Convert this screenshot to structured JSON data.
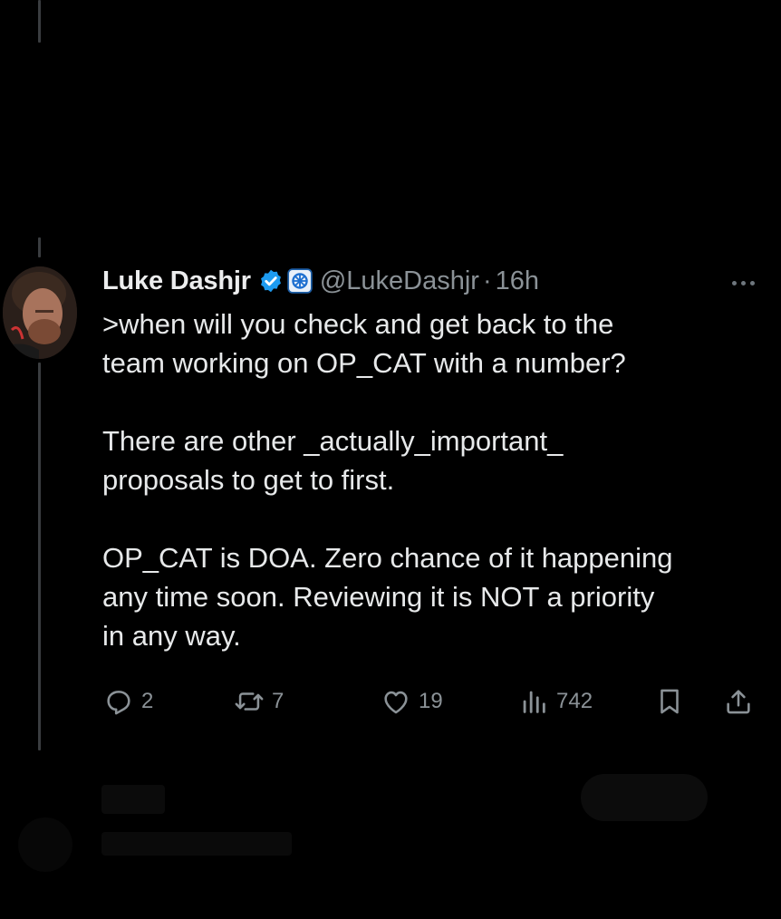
{
  "tweet": {
    "author_name": "Luke Dashjr",
    "handle": "@LukeDashjr",
    "separator": "·",
    "time": "16h",
    "text_lines": [
      ">when will you check and get back to the",
      "team working on OP_CAT with a number?",
      "",
      "There are other _actually_important_",
      "proposals to get to first.",
      "",
      "OP_CAT is DOA. Zero chance of it happening",
      "any time soon. Reviewing it is NOT a priority",
      "in any way."
    ]
  },
  "actions": {
    "replies": "2",
    "reposts": "7",
    "likes": "19",
    "views": "742"
  },
  "icons": {
    "verified": "verified-badge-icon",
    "affiliate": "affiliate-badge-icon",
    "more": "more-options-icon",
    "reply": "reply-icon",
    "repost": "repost-icon",
    "like": "like-icon",
    "views": "views-icon",
    "bookmark": "bookmark-icon",
    "share": "share-icon"
  },
  "colors": {
    "background": "#000000",
    "text": "#e7e9ea",
    "secondary_text": "#8b9297",
    "verified_blue": "#1d9bf0"
  }
}
